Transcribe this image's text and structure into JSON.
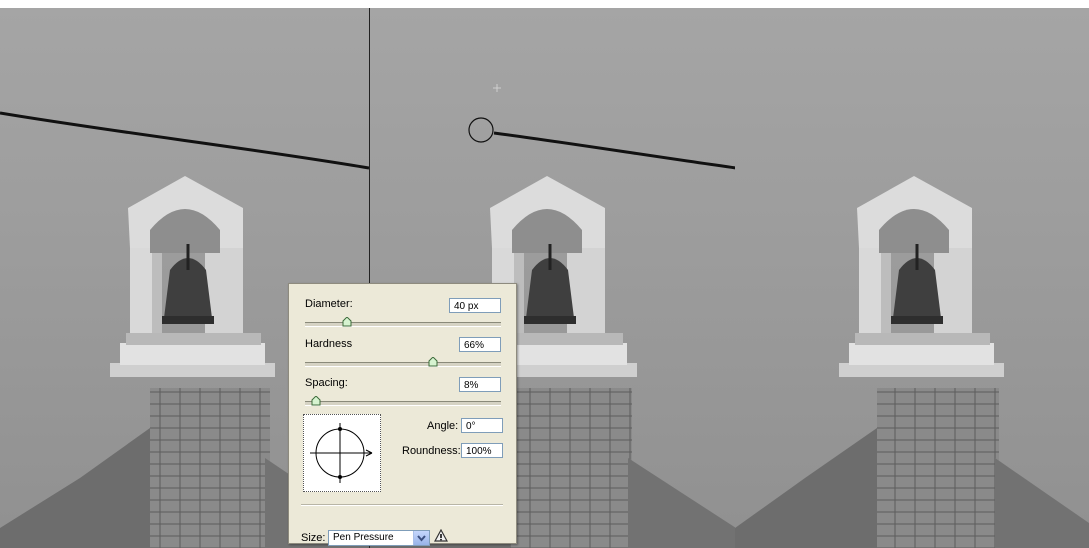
{
  "brush_options": {
    "diameter": {
      "label": "Diameter:",
      "value": "40 px",
      "slider_fraction": 0.2
    },
    "hardness": {
      "label": "Hardness",
      "value": "66%",
      "slider_fraction": 0.66
    },
    "spacing": {
      "label": "Spacing:",
      "value": "8%",
      "slider_fraction": 0.03
    },
    "angle": {
      "label": "Angle:",
      "value": "0°"
    },
    "roundness": {
      "label": "Roundness:",
      "value": "100%"
    },
    "size_control": {
      "label": "Size:",
      "selected": "Pen Pressure"
    }
  },
  "icons": {
    "warning": "warning-icon",
    "dropdown": "chevron-down-icon",
    "crosshair": "crosshair-icon",
    "brush_cursor": "brush-cursor-icon"
  },
  "colors": {
    "sky": "#9e9e9e",
    "dialog_bg": "#ece9d8",
    "field_border": "#7f9db9",
    "slider_thumb": "#d6f3d0"
  }
}
